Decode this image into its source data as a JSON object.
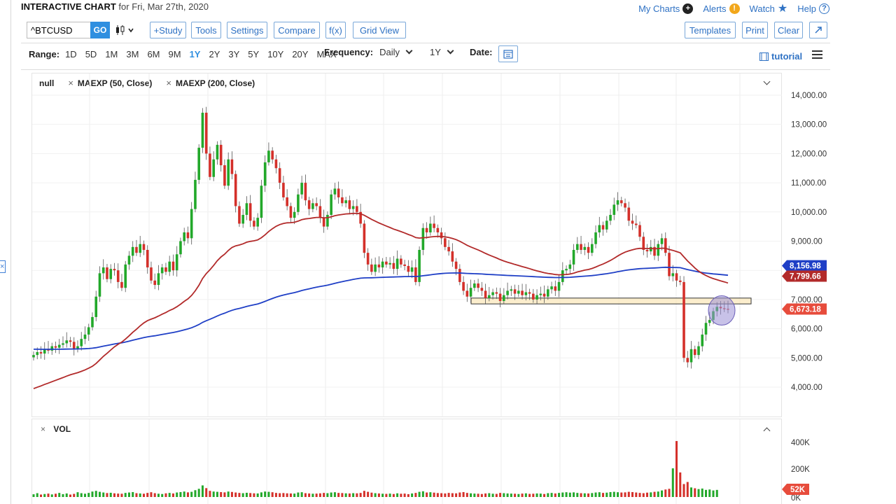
{
  "header": {
    "title": "INTERACTIVE CHART",
    "subtitle": "for Fri, Mar 27th, 2020",
    "links": [
      {
        "label": "My Charts",
        "icon": "plus-circle-icon"
      },
      {
        "label": "Alerts",
        "icon": "alert-icon"
      },
      {
        "label": "Watch",
        "icon": "star-icon"
      },
      {
        "label": "Help",
        "icon": "question-icon"
      }
    ]
  },
  "toolbar": {
    "symbol": "^BTCUSD",
    "go_label": "GO",
    "chart_type_icon": "candlestick-icon",
    "study_label": "+Study",
    "tools_label": "Tools",
    "settings_label": "Settings",
    "compare_label": "Compare",
    "fx_label": "f(x)",
    "gridview_label": "Grid View",
    "templates_label": "Templates",
    "print_label": "Print",
    "clear_label": "Clear",
    "expand_icon": "expand-icon"
  },
  "range": {
    "label": "Range:",
    "options": [
      "1D",
      "5D",
      "1M",
      "3M",
      "6M",
      "9M",
      "1Y",
      "2Y",
      "3Y",
      "5Y",
      "10Y",
      "20Y",
      "MAX"
    ],
    "active": "1Y",
    "frequency_label": "Frequency:",
    "frequency_value": "Daily",
    "period_value": "1Y",
    "date_label": "Date:",
    "tutorial_label": "tutorial"
  },
  "studies": {
    "items": [
      "null",
      "MAEXP (50, Close)",
      "MAEXP (200, Close)"
    ]
  },
  "volume": {
    "label": "VOL"
  },
  "colors": {
    "up": "#22a82a",
    "down": "#d4302a",
    "ma50": "#b22a2a",
    "ma200": "#1f3fc6",
    "accent": "#2f8fe0"
  },
  "chart_data": {
    "type": "candlestick",
    "yaxis_ticks": [
      "14,000.00",
      "13,000.00",
      "12,000.00",
      "11,000.00",
      "10,000.00",
      "9,000.00",
      "8,000.00",
      "7,000.00",
      "6,000.00",
      "5,000.00",
      "4,000.00"
    ],
    "ylim": [
      3400,
      14500
    ],
    "price_labels": [
      {
        "label": "8,156.98",
        "value": 8156.98,
        "color": "#1f3fc6"
      },
      {
        "label": "7,799.66",
        "value": 7799.66,
        "color": "#b22a2a"
      },
      {
        "label": "6,673.18",
        "value": 6673.18,
        "color": "#e74c3c"
      }
    ],
    "series_close": [
      5100,
      5200,
      5150,
      5300,
      5250,
      5400,
      5350,
      5450,
      5500,
      5600,
      5550,
      5300,
      5400,
      5650,
      5800,
      6050,
      6400,
      7100,
      7900,
      8100,
      7700,
      8050,
      8000,
      7600,
      7400,
      8200,
      8500,
      8800,
      8600,
      8900,
      8700,
      8100,
      7650,
      7500,
      7900,
      8100,
      7950,
      8300,
      8000,
      8550,
      9000,
      9300,
      9100,
      10100,
      11100,
      12200,
      13400,
      12000,
      11200,
      11800,
      12300,
      11600,
      10900,
      11800,
      11300,
      10200,
      9600,
      9900,
      10300,
      9700,
      9500,
      9800,
      10900,
      11700,
      12100,
      11800,
      11500,
      11000,
      10500,
      10200,
      9800,
      10000,
      10600,
      11000,
      10400,
      10100,
      10300,
      10200,
      9800,
      9500,
      9900,
      10600,
      10800,
      10500,
      10300,
      10400,
      10100,
      10200,
      10000,
      9600,
      8600,
      8200,
      7950,
      8200,
      8100,
      8300,
      8200,
      8250,
      8050,
      8400,
      8200,
      8150,
      7950,
      8100,
      7600,
      8700,
      9450,
      9300,
      9600,
      9450,
      9300,
      9100,
      8800,
      8650,
      8300,
      8050,
      7600,
      7300,
      7100,
      7400,
      7550,
      7400,
      7300,
      7050,
      7150,
      7250,
      7200,
      6950,
      7150,
      7300,
      7350,
      7200,
      7300,
      7150,
      7250,
      7200,
      7000,
      7150,
      7200,
      7100,
      7350,
      7450,
      7300,
      7600,
      8000,
      8050,
      8200,
      8700,
      8900,
      8700,
      8800,
      8600,
      8900,
      9300,
      9550,
      9400,
      9700,
      9900,
      10250,
      10400,
      10300,
      10150,
      9700,
      9600,
      9550,
      9150,
      8700,
      8650,
      8800,
      8500,
      8900,
      9100,
      8600,
      7800,
      7900,
      7650,
      7600,
      5000,
      4850,
      5300,
      5100,
      5400,
      5800,
      6200,
      6300,
      6600,
      6750,
      6700,
      6680,
      6673
    ],
    "series_volume_k": [
      20,
      28,
      18,
      22,
      25,
      19,
      24,
      30,
      21,
      26,
      18,
      23,
      35,
      28,
      24,
      30,
      40,
      45,
      38,
      33,
      29,
      31,
      27,
      25,
      24,
      30,
      33,
      36,
      28,
      26,
      24,
      30,
      35,
      28,
      24,
      22,
      27,
      30,
      26,
      33,
      36,
      40,
      34,
      38,
      50,
      60,
      85,
      65,
      45,
      40,
      38,
      36,
      34,
      40,
      37,
      33,
      30,
      28,
      31,
      29,
      27,
      26,
      34,
      40,
      38,
      35,
      30,
      28,
      29,
      27,
      26,
      25,
      33,
      35,
      28,
      26,
      24,
      25,
      27,
      30,
      28,
      33,
      35,
      30,
      29,
      27,
      26,
      28,
      27,
      30,
      45,
      38,
      32,
      28,
      26,
      24,
      23,
      25,
      22,
      27,
      24,
      25,
      21,
      26,
      30,
      38,
      42,
      33,
      35,
      32,
      29,
      28,
      26,
      30,
      28,
      27,
      33,
      36,
      30,
      27,
      25,
      24,
      22,
      26,
      28,
      24,
      23,
      30,
      28,
      26,
      25,
      24,
      22,
      25,
      27,
      23,
      24,
      26,
      25,
      22,
      28,
      30,
      26,
      30,
      33,
      35,
      32,
      34,
      30,
      28,
      27,
      26,
      29,
      33,
      35,
      30,
      32,
      36,
      38,
      35,
      33,
      34,
      38,
      36,
      33,
      30,
      28,
      32,
      34,
      38,
      40,
      48,
      55,
      60,
      210,
      410,
      180,
      95,
      110,
      70,
      64,
      58,
      62,
      52,
      55,
      48,
      52
    ],
    "volume_axis": [
      "400K",
      "200K",
      "0K"
    ],
    "volume_last_label": "52K",
    "annotations": {
      "support_zone": [
        6850,
        7050
      ],
      "highlight_circle_at": 6673
    }
  }
}
